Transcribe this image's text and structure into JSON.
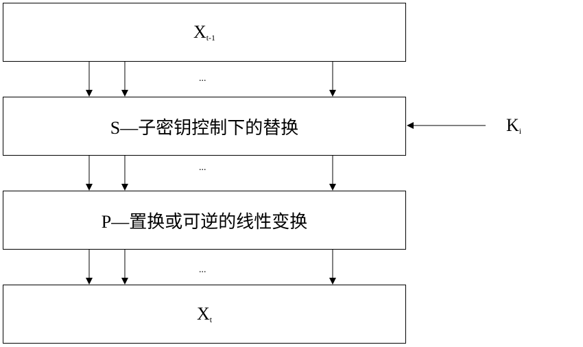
{
  "diagram": {
    "boxes": {
      "input": {
        "main": "X",
        "sub": "t-1"
      },
      "s_layer": {
        "label": "S—子密钥控制下的替换"
      },
      "p_layer": {
        "label": "P—置换或可逆的线性变换"
      },
      "output": {
        "main": "X",
        "sub": "t"
      }
    },
    "ellipsis": "...",
    "key": {
      "main": "K",
      "sub": "i"
    }
  }
}
